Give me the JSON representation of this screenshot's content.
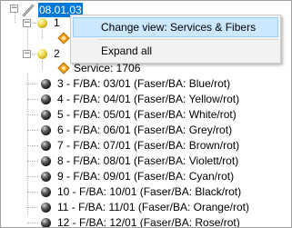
{
  "tree": {
    "root": {
      "label": "08.01.03",
      "icon": "pencil-icon",
      "selected": true
    },
    "nodes": [
      {
        "label": "1",
        "icon": "yellow-ball-icon"
      },
      {
        "label": "2",
        "icon": "yellow-ball-icon"
      }
    ],
    "service": {
      "label": "Service: 1706",
      "icon": "service-icon"
    },
    "fibers": [
      "3 - F/BA: 03/01 (Faser/BA: Blue/rot)",
      "4 - F/BA: 04/01 (Faser/BA: Yellow/rot)",
      "5 - F/BA: 05/01 (Faser/BA: White/rot)",
      "6 - F/BA: 06/01 (Faser/BA: Grey/rot)",
      "7 - F/BA: 07/01 (Faser/BA: Brown/rot)",
      "8 - F/BA: 08/01 (Faser/BA: Violett/rot)",
      "9 - F/BA: 09/01 (Faser/BA: Cyan/rot)",
      "10 - F/BA: 10/01 (Faser/BA: Black/rot)",
      "11 - F/BA: 11/01 (Faser/BA: Orange/rot)",
      "12 - F/BA: 12/01 (Faser/BA: Rose/rot)"
    ]
  },
  "context_menu": {
    "items": [
      {
        "label": "Change view: Services & Fibers",
        "highlighted": true
      },
      {
        "label": "Expand all",
        "highlighted": false
      }
    ]
  },
  "colors": {
    "selection": "#0078d7",
    "menu_highlight": "#cce8ff",
    "menu_background": "#f2f2f2"
  }
}
